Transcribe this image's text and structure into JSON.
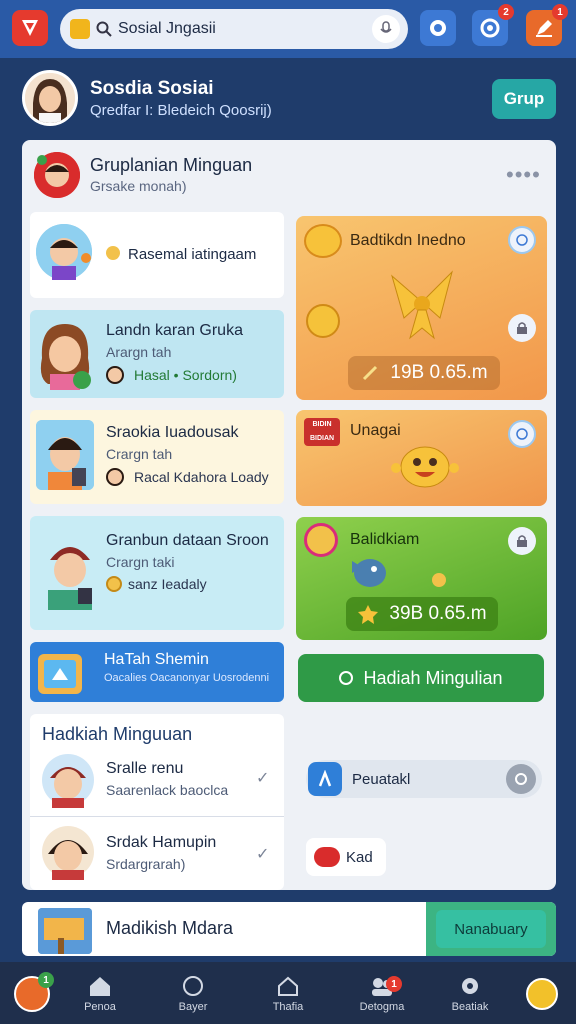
{
  "search": {
    "value": "Sosial Jngasii"
  },
  "topbar": {
    "badge_b": "2",
    "badge_c": "1"
  },
  "profile": {
    "name": "Sosdia Sosiai",
    "subtitle": "Qredfar I: Bledeich Qoosrij)",
    "grup_label": "Grup"
  },
  "group": {
    "title": "Gruplanian Minguan",
    "subtitle": "Grsake monah)",
    "more": "••••"
  },
  "cards": [
    {
      "title": "Rasemal iatingaam"
    },
    {
      "title": "Landn karan Gruka",
      "subtitle": "Arargn tah",
      "line": "Hasal • Sordorn)"
    },
    {
      "title": "Sraokia Iuadousak",
      "subtitle": "Crargn tah",
      "line": "Racal Kdahora Loady"
    },
    {
      "title": "Granbun dataan Sroon",
      "subtitle": "Crargn taki",
      "line": "sanz Ieadaly"
    },
    {
      "title": "HaTah Shemin",
      "subtitle": "Oacalies Oacanonyar Uosrodenni"
    }
  ],
  "rewards": [
    {
      "title": "Badtikdn Inedno",
      "amount": "19B 0.65.m"
    },
    {
      "title": "Unagai",
      "sticker": "BIDIN BIDIAN"
    },
    {
      "title": "Balidkiam",
      "amount": "39B 0.65.m"
    }
  ],
  "hadiah_button": "Hadiah Mingulian",
  "weekly": {
    "title": "Hadkiah Minguuan",
    "items": [
      {
        "name": "Sralle renu",
        "sub": "Saarenlack baoclca"
      },
      {
        "name": "Srdak Hamupin",
        "sub": "Srdargrarah)"
      }
    ]
  },
  "side": {
    "feed_label": "Peuatakl",
    "kad_label": "Kad"
  },
  "banner": {
    "text": "Madikish Mdara",
    "button": "Nanabuary"
  },
  "nav": {
    "items": [
      {
        "label": "Penoa"
      },
      {
        "label": "Bayer"
      },
      {
        "label": "Thafia"
      },
      {
        "label": "Detogma",
        "badge": "1"
      },
      {
        "label": "Beatiak"
      }
    ],
    "profile_badge": "1"
  },
  "colors": {
    "accent": "#2a5aa6",
    "green": "#2f9a47",
    "orange": "#f2974a",
    "teal": "#26a7a5"
  }
}
